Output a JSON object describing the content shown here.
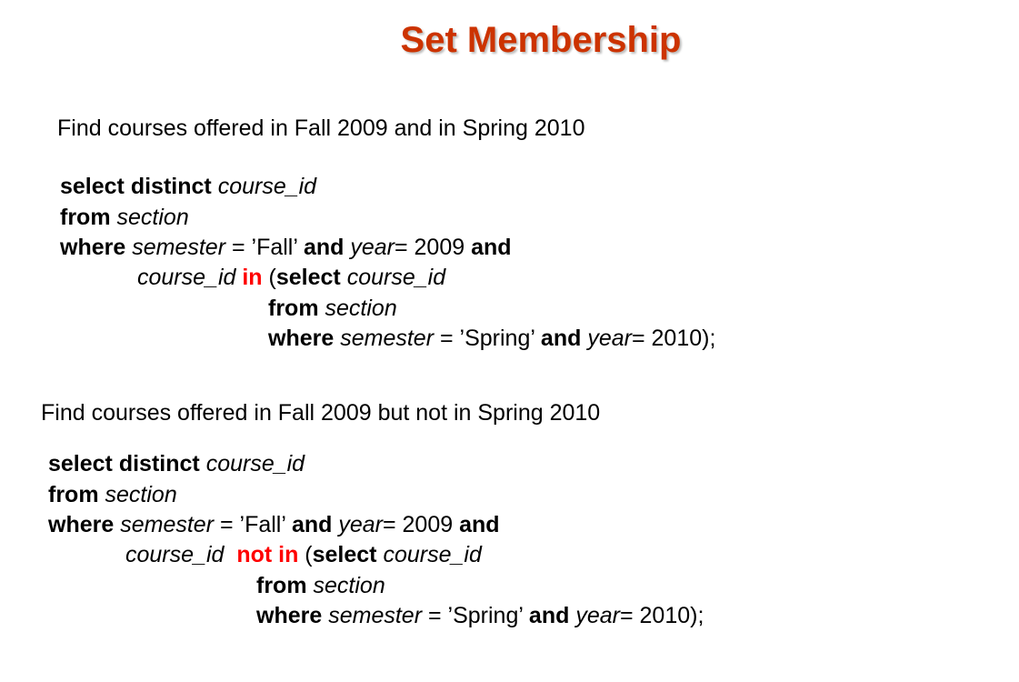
{
  "slide": {
    "title": "Set Membership"
  },
  "example1": {
    "prompt": "Find courses offered in Fall 2009 and in Spring 2010",
    "lines": [
      [
        {
          "t": "select distinct",
          "s": "kw"
        },
        {
          "t": " ",
          "s": "plain"
        },
        {
          "t": "course_id",
          "s": "id"
        }
      ],
      [
        {
          "t": "from",
          "s": "kw"
        },
        {
          "t": " ",
          "s": "plain"
        },
        {
          "t": "section",
          "s": "id"
        }
      ],
      [
        {
          "t": "where",
          "s": "kw"
        },
        {
          "t": " ",
          "s": "plain"
        },
        {
          "t": "semester",
          "s": "id"
        },
        {
          "t": " = ’Fall’ ",
          "s": "plain"
        },
        {
          "t": "and",
          "s": "kw"
        },
        {
          "t": " ",
          "s": "plain"
        },
        {
          "t": "year",
          "s": "id"
        },
        {
          "t": "= 2009 ",
          "s": "plain"
        },
        {
          "t": "and",
          "s": "kw"
        }
      ],
      [
        {
          "t": "course_id",
          "s": "id"
        },
        {
          "t": " ",
          "s": "plain"
        },
        {
          "t": "in",
          "s": "hl"
        },
        {
          "t": " (",
          "s": "plain"
        },
        {
          "t": "select",
          "s": "kw"
        },
        {
          "t": " ",
          "s": "plain"
        },
        {
          "t": "course_id",
          "s": "id"
        }
      ],
      [
        {
          "t": "from",
          "s": "kw"
        },
        {
          "t": " ",
          "s": "plain"
        },
        {
          "t": "section",
          "s": "id"
        }
      ],
      [
        {
          "t": "where",
          "s": "kw"
        },
        {
          "t": " ",
          "s": "plain"
        },
        {
          "t": "semester",
          "s": "id"
        },
        {
          "t": " = ’Spring’ ",
          "s": "plain"
        },
        {
          "t": "and",
          "s": "kw"
        },
        {
          "t": " ",
          "s": "plain"
        },
        {
          "t": "year",
          "s": "id"
        },
        {
          "t": "= 2010);",
          "s": "plain"
        }
      ]
    ]
  },
  "example2": {
    "prompt": "Find courses offered in Fall 2009 but not in Spring 2010",
    "lines": [
      [
        {
          "t": "select distinct",
          "s": "kw"
        },
        {
          "t": " ",
          "s": "plain"
        },
        {
          "t": "course_id",
          "s": "id"
        }
      ],
      [
        {
          "t": "from",
          "s": "kw"
        },
        {
          "t": " ",
          "s": "plain"
        },
        {
          "t": "section",
          "s": "id"
        }
      ],
      [
        {
          "t": "where",
          "s": "kw"
        },
        {
          "t": " ",
          "s": "plain"
        },
        {
          "t": "semester",
          "s": "id"
        },
        {
          "t": " = ’Fall’ ",
          "s": "plain"
        },
        {
          "t": "and",
          "s": "kw"
        },
        {
          "t": " ",
          "s": "plain"
        },
        {
          "t": "year",
          "s": "id"
        },
        {
          "t": "= 2009 ",
          "s": "plain"
        },
        {
          "t": "and",
          "s": "kw"
        }
      ],
      [
        {
          "t": "course_id",
          "s": "id"
        },
        {
          "t": "  ",
          "s": "plain"
        },
        {
          "t": "not in",
          "s": "hl"
        },
        {
          "t": " (",
          "s": "plain"
        },
        {
          "t": "select",
          "s": "kw"
        },
        {
          "t": " ",
          "s": "plain"
        },
        {
          "t": "course_id",
          "s": "id"
        }
      ],
      [
        {
          "t": "from",
          "s": "kw"
        },
        {
          "t": " ",
          "s": "plain"
        },
        {
          "t": "section",
          "s": "id"
        }
      ],
      [
        {
          "t": "where",
          "s": "kw"
        },
        {
          "t": " ",
          "s": "plain"
        },
        {
          "t": "semester",
          "s": "id"
        },
        {
          "t": " = ’Spring’ ",
          "s": "plain"
        },
        {
          "t": "and",
          "s": "kw"
        },
        {
          "t": " ",
          "s": "plain"
        },
        {
          "t": "year",
          "s": "id"
        },
        {
          "t": "= 2010);",
          "s": "plain"
        }
      ]
    ]
  },
  "colors": {
    "title": "#cc3300",
    "highlight": "#ff0000",
    "text": "#000000"
  }
}
